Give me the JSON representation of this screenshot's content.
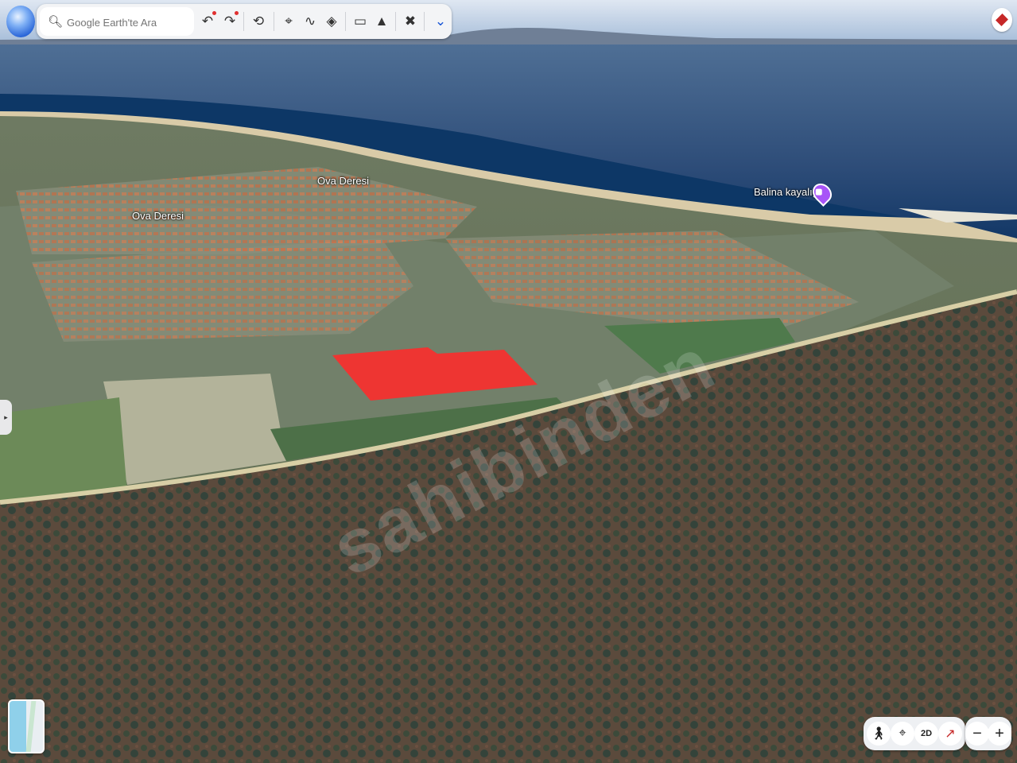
{
  "toolbar": {
    "search_placeholder": "Google Earth'te Ara",
    "icons": [
      "search-icon",
      "undo-icon",
      "redo-icon",
      "history-icon",
      "placemark-icon",
      "path-icon",
      "layers-icon",
      "measure-icon",
      "photo-icon",
      "projects-icon",
      "expand-icon"
    ]
  },
  "map": {
    "labels": {
      "ova_deresi_1": "Ova Deresi",
      "ova_deresi_2": "Ova Deresi",
      "poi": "Balina kayalığı"
    },
    "watermark": "sahibinden"
  },
  "controls": {
    "mode_2d": "2D",
    "zoom_out": "−",
    "zoom_in": "+"
  },
  "colors": {
    "parcel": "#ff2a2a",
    "poi": "#a855f7",
    "toolbar": "#f3f4f6"
  }
}
